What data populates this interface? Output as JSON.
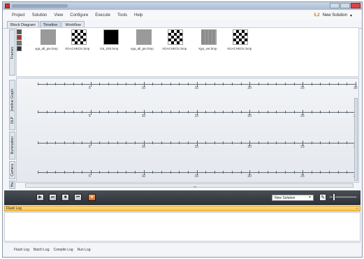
{
  "menu": [
    "Project",
    "Solution",
    "View",
    "Configure",
    "Execute",
    "Tools",
    "Help"
  ],
  "solution_indicator": {
    "icon": "5,2",
    "label": "New Solution"
  },
  "tabs": [
    "Block Diagram",
    "Timeline",
    "Workflow"
  ],
  "left_tabs": [
    "Frames",
    "Timeline Graph",
    "DLP",
    "Illumination",
    "Camera",
    "Hw"
  ],
  "frames": [
    {
      "label": "xga_all_pie.bmp",
      "style": "gray"
    },
    {
      "label": "XGACHECK.bmp",
      "style": "check"
    },
    {
      "label": "I16_020.bmp",
      "style": "black"
    },
    {
      "label": "xga_all_pie.bmp",
      "style": "gray"
    },
    {
      "label": "XGACHECK.bmp",
      "style": "check"
    },
    {
      "label": "Xga_ver.bmp",
      "style": "stripes"
    },
    {
      "label": "XGACHECK.bmp",
      "style": "check"
    }
  ],
  "timeline_ticks": [
    "5",
    "10",
    "15",
    "20",
    "25",
    "30"
  ],
  "transport": {
    "buttons": [
      "play-icon",
      "step-forward-icon",
      "stop-icon",
      "step-back-icon",
      "record-icon"
    ],
    "solution_select": "New Solution"
  },
  "log": {
    "title": "Flash Log"
  },
  "bottom_tabs": [
    "Flash Log",
    "Batch Log",
    "Compile Log",
    "Run Log"
  ],
  "colors": {
    "accent": "#d96a1c",
    "log_header": "#f7c24a",
    "transport_bg": "#2c3036"
  }
}
